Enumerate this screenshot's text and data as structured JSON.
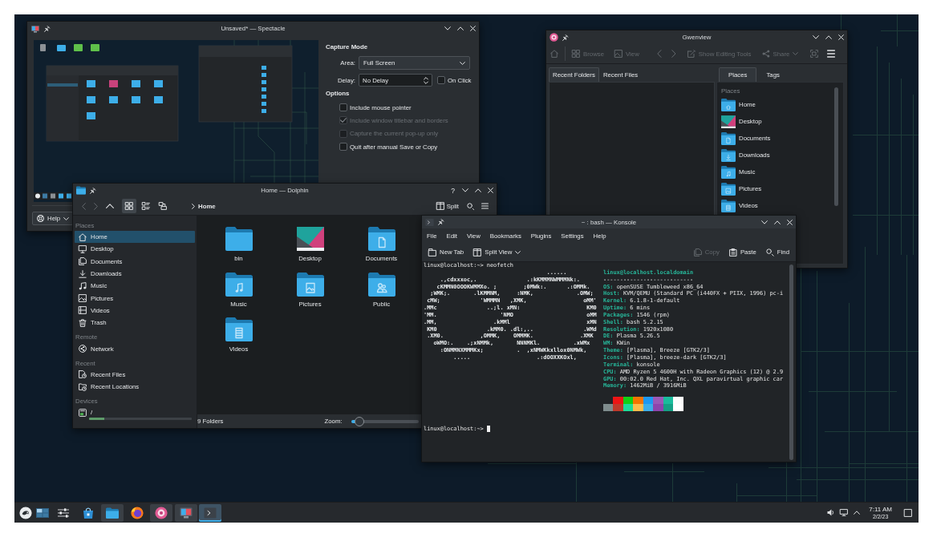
{
  "spectacle": {
    "title": "Unsaved* — Spectacle",
    "capture_heading": "Capture Mode",
    "area": {
      "label": "Area:",
      "value": "Full Screen"
    },
    "delay": {
      "label": "Delay:",
      "value": "No Delay"
    },
    "on_click": {
      "label": "On Click",
      "checked": false
    },
    "options_heading": "Options",
    "options": [
      {
        "label": "Include mouse pointer",
        "checked": false,
        "disabled": false
      },
      {
        "label": "Include window titlebar and borders",
        "checked": true,
        "disabled": true
      },
      {
        "label": "Capture the current pop-up only",
        "checked": false,
        "disabled": true
      },
      {
        "label": "Quit after manual Save or Copy",
        "checked": false,
        "disabled": false
      }
    ],
    "help_button": "Help"
  },
  "gwenview": {
    "title": "Gwenview",
    "toolbar": [
      {
        "kind": "home",
        "disabled": true
      },
      {
        "kind": "browse",
        "label": "Browse",
        "disabled": true
      },
      {
        "kind": "view",
        "label": "View",
        "disabled": true
      },
      {
        "kind": "back",
        "disabled": true
      },
      {
        "kind": "forward",
        "disabled": true
      },
      {
        "kind": "edit",
        "label": "Show Editing Tools",
        "disabled": true
      },
      {
        "kind": "share",
        "label": "Share",
        "disabled": true
      },
      {
        "kind": "fullscreen",
        "disabled": true
      },
      {
        "kind": "menu",
        "disabled": false
      }
    ],
    "left_tabs": [
      {
        "label": "Recent Folders",
        "selected": true
      },
      {
        "label": "Recent Files",
        "selected": false
      }
    ],
    "right_tabs": [
      {
        "label": "Places",
        "selected": true
      },
      {
        "label": "Tags",
        "selected": false
      }
    ],
    "places_heading": "Places",
    "places": [
      {
        "label": "Home",
        "kind": "home"
      },
      {
        "label": "Desktop",
        "kind": "desktop"
      },
      {
        "label": "Documents",
        "kind": "documents"
      },
      {
        "label": "Downloads",
        "kind": "downloads"
      },
      {
        "label": "Music",
        "kind": "music"
      },
      {
        "label": "Pictures",
        "kind": "pictures"
      },
      {
        "label": "Videos",
        "kind": "videos"
      }
    ]
  },
  "dolphin": {
    "title": "Home — Dolphin",
    "help_button": "?",
    "navigation": [
      {
        "kind": "back",
        "disabled": true
      },
      {
        "kind": "forward",
        "disabled": true
      },
      {
        "kind": "up",
        "disabled": false
      }
    ],
    "view_modes": [
      {
        "kind": "icons",
        "selected": true
      },
      {
        "kind": "compact",
        "selected": false
      },
      {
        "kind": "details",
        "selected": false
      }
    ],
    "breadcrumb": "Home",
    "split_button": "Split",
    "places": [
      {
        "heading": "Places",
        "items": [
          {
            "label": "Home",
            "kind": "home",
            "selected": true
          },
          {
            "label": "Desktop",
            "kind": "desktop",
            "selected": false
          },
          {
            "label": "Documents",
            "kind": "documents",
            "selected": false
          },
          {
            "label": "Downloads",
            "kind": "downloads",
            "selected": false
          },
          {
            "label": "Music",
            "kind": "music",
            "selected": false
          },
          {
            "label": "Pictures",
            "kind": "pictures",
            "selected": false
          },
          {
            "label": "Videos",
            "kind": "videos",
            "selected": false
          },
          {
            "label": "Trash",
            "kind": "trash",
            "selected": false
          }
        ]
      },
      {
        "heading": "Remote",
        "items": [
          {
            "label": "Network",
            "kind": "network",
            "selected": false
          }
        ]
      },
      {
        "heading": "Recent",
        "items": [
          {
            "label": "Recent Files",
            "kind": "recent-files",
            "selected": false
          },
          {
            "label": "Recent Locations",
            "kind": "recent-locations",
            "selected": false
          }
        ]
      },
      {
        "heading": "Devices",
        "items": [
          {
            "label": "/",
            "kind": "drive",
            "selected": false,
            "level": 0.15
          }
        ]
      }
    ],
    "folders": [
      {
        "name": "bin",
        "kind": "plain"
      },
      {
        "name": "Desktop",
        "kind": "desktop"
      },
      {
        "name": "Documents",
        "kind": "documents"
      },
      {
        "name": "Music",
        "kind": "music"
      },
      {
        "name": "Pictures",
        "kind": "pictures"
      },
      {
        "name": "Public",
        "kind": "public"
      },
      {
        "name": "Videos",
        "kind": "videos"
      }
    ],
    "status": "9 Folders",
    "zoom": {
      "label": "Zoom:",
      "level": 0.12
    }
  },
  "konsole": {
    "title": "~ : bash — Konsole",
    "menu": [
      "File",
      "Edit",
      "View",
      "Bookmarks",
      "Plugins",
      "Settings",
      "Help"
    ],
    "toolbar": [
      {
        "kind": "new-tab",
        "label": "New Tab",
        "disabled": false
      },
      {
        "kind": "split-view",
        "label": "Split View",
        "disabled": false
      },
      {
        "kind": "copy",
        "label": "Copy",
        "disabled": true
      },
      {
        "kind": "paste",
        "label": "Paste",
        "disabled": false
      },
      {
        "kind": "find",
        "label": "Find",
        "disabled": false
      }
    ],
    "terminal": {
      "command_line": "linux@localhost:~> neofetch",
      "logo_lines": [
        "                                     ......",
        "     .,cdxxxoc,.               .:kKMMMNWMMMNk:.",
        "    cKMMN0OOOKWMMXo. ;        ;0MWk:.      .:OMMk.",
        "  ;WMK;.       .lKMMNM,     :NMK,             .OMW;",
        " cMW;            'WMMMN   ,XMK,                 oMM'",
        ".MMc               ..;l. xMN:                    KM0",
        "'MM.                   'NMO                      oMM",
        ".MM,                 .kMMl                       xMN",
        " KM0               .kMM0. .dl:,..               .WMd",
        " .XM0.           ,OMMK,    OMMMK.              .XMK",
        "   oWMO:.    .;xNMMk,       NNNMKl.          .xWMx",
        "     :ONMMNXMMMKx;          .  ,xNMWKkxllox0NMWk,",
        "         .....                    .:dOOXXKOxl,"
      ],
      "user_host": "linux@localhost.localdomain",
      "separator": "---------------------------",
      "info": [
        {
          "key": "OS:",
          "value": "openSUSE Tumbleweed x86_64"
        },
        {
          "key": "Host:",
          "value": "KVM/QEMU (Standard PC (i440FX + PIIX, 1996) pc-i"
        },
        {
          "key": "Kernel:",
          "value": "6.1.8-1-default"
        },
        {
          "key": "Uptime:",
          "value": "6 mins"
        },
        {
          "key": "Packages:",
          "value": "1546 (rpm)"
        },
        {
          "key": "Shell:",
          "value": "bash 5.2.15"
        },
        {
          "key": "Resolution:",
          "value": "1920x1080"
        },
        {
          "key": "DE:",
          "value": "Plasma 5.26.5"
        },
        {
          "key": "WM:",
          "value": "KWin"
        },
        {
          "key": "Theme:",
          "value": "[Plasma], Breeze [GTK2/3]"
        },
        {
          "key": "Icons:",
          "value": "[Plasma], breeze-dark [GTK2/3]"
        },
        {
          "key": "Terminal:",
          "value": "konsole"
        },
        {
          "key": "CPU:",
          "value": "AMD Ryzen 5 4600H with Radeon Graphics (12) @ 2.9"
        },
        {
          "key": "GPU:",
          "value": "00:02.0 Red Hat, Inc. QXL paravirtual graphic car"
        },
        {
          "key": "Memory:",
          "value": "1462MiB / 3916MiB"
        }
      ],
      "palette": {
        "top": [
          {
            "color": "#ed1515"
          },
          {
            "color": "#11d116"
          },
          {
            "color": "#f67400"
          },
          {
            "color": "#1d99f3"
          },
          {
            "color": "#9b59b6"
          },
          {
            "color": "#1abc9c"
          },
          {
            "color": "#fcfcfc"
          }
        ],
        "bottom": [
          {
            "color": "#7f8c8d"
          },
          {
            "color": "#c0392b"
          },
          {
            "color": "#1cdc9a"
          },
          {
            "color": "#fdbc4b"
          },
          {
            "color": "#3daee9"
          },
          {
            "color": "#8e44ad"
          },
          {
            "color": "#16a085"
          },
          {
            "color": "#ffffff"
          }
        ]
      },
      "prompt": "linux@localhost:~>"
    }
  },
  "taskbar": {
    "tasks": [
      {
        "kind": "menu",
        "open": false,
        "selected": false
      },
      {
        "kind": "pager",
        "open": false,
        "selected": false
      },
      {
        "kind": "settings",
        "open": false,
        "selected": false
      },
      {
        "kind": "store",
        "open": false,
        "selected": false
      },
      {
        "kind": "files",
        "open": true,
        "selected": false
      },
      {
        "kind": "browser",
        "open": false,
        "selected": false
      },
      {
        "kind": "viewer",
        "open": true,
        "selected": false
      },
      {
        "kind": "screenshot",
        "open": true,
        "selected": false
      },
      {
        "kind": "terminal",
        "open": true,
        "selected": true
      }
    ],
    "clock": {
      "time": "7:11 AM",
      "date": "2/2/23"
    }
  }
}
